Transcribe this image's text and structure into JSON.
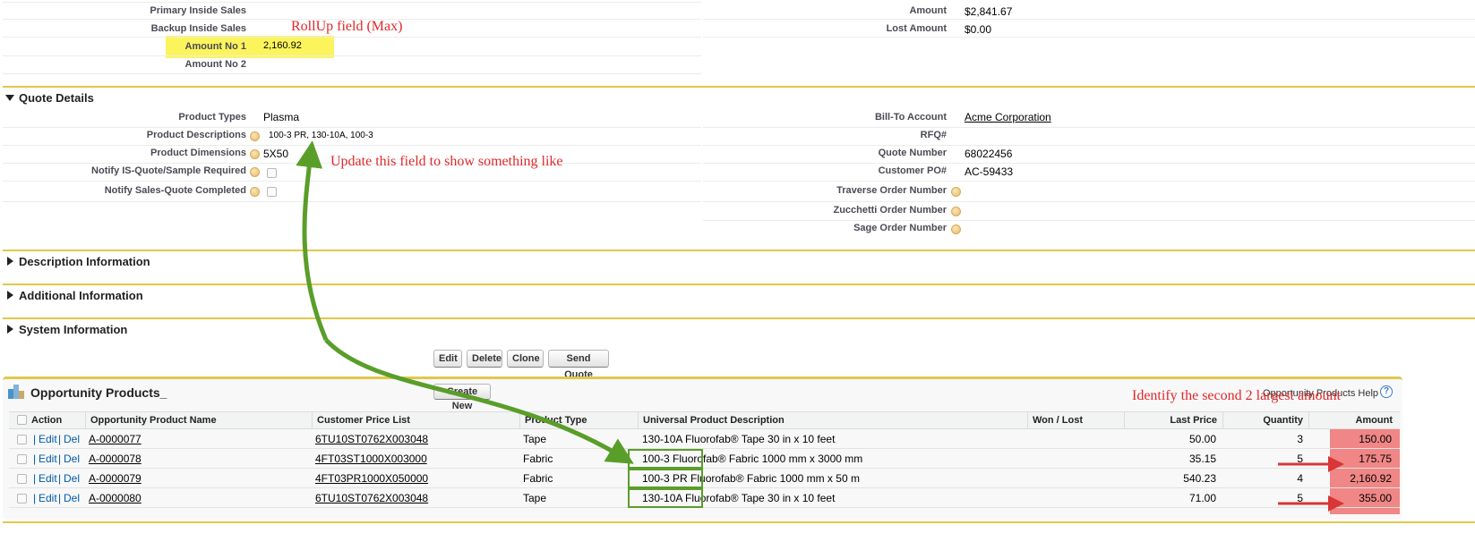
{
  "top_fields": {
    "primary_inside_sales": {
      "label": "Primary Inside Sales",
      "value": ""
    },
    "backup_inside_sales": {
      "label": "Backup Inside Sales",
      "value": ""
    },
    "amount_no_1": {
      "label": "Amount No 1",
      "value": "2,160.92"
    },
    "amount_no_2": {
      "label": "Amount No 2",
      "value": ""
    },
    "amount": {
      "label": "Amount",
      "value": "$2,841.67"
    },
    "lost_amount": {
      "label": "Lost Amount",
      "value": "$0.00"
    }
  },
  "quote_details": {
    "title": "Quote Details",
    "product_types": {
      "label": "Product Types",
      "value": "Plasma"
    },
    "product_descriptions": {
      "label": "Product Descriptions",
      "value": "100-3 PR, 130-10A, 100-3"
    },
    "product_dimensions": {
      "label": "Product Dimensions",
      "value": "5X50"
    },
    "notify_is_quote": {
      "label": "Notify IS-Quote/Sample Required"
    },
    "notify_sales_quote": {
      "label": "Notify Sales-Quote Completed"
    },
    "bill_to_account": {
      "label": "Bill-To Account",
      "value": "Acme Corporation"
    },
    "rfq": {
      "label": "RFQ#",
      "value": ""
    },
    "quote_number": {
      "label": "Quote Number",
      "value": "68022456"
    },
    "customer_po": {
      "label": "Customer PO#",
      "value": "AC-59433"
    },
    "traverse_order": {
      "label": "Traverse Order Number"
    },
    "zucchetti_order": {
      "label": "Zucchetti Order Number"
    },
    "sage_order": {
      "label": "Sage Order Number"
    }
  },
  "sections": {
    "description": "Description Information",
    "additional": "Additional Information",
    "system": "System Information"
  },
  "buttons": {
    "edit": "Edit",
    "delete": "Delete",
    "clone": "Clone",
    "send_quote": "Send Quote",
    "create_new": "Create New"
  },
  "related_list": {
    "title": "Opportunity Products_",
    "help_link": "Opportunity Products Help",
    "help_icon": "?",
    "columns": {
      "action": "Action",
      "name": "Opportunity Product Name",
      "price_list": "Customer Price List",
      "type": "Product Type",
      "desc": "Universal Product Description",
      "won_lost": "Won / Lost",
      "last_price": "Last Price",
      "quantity": "Quantity",
      "amount": "Amount"
    },
    "action_links": {
      "sep": "|",
      "edit": "Edit",
      "del": "Del"
    },
    "rows": [
      {
        "name": "A-0000077",
        "price_list": "6TU10ST0762X003048",
        "type": "Tape",
        "desc": "130-10A Fluorofab® Tape 30 in x 10 feet",
        "won_lost": "",
        "last_price": "50.00",
        "quantity": "3",
        "amount": "150.00"
      },
      {
        "name": "A-0000078",
        "price_list": "4FT03ST1000X003000",
        "type": "Fabric",
        "desc": "100-3 Fluorofab® Fabric 1000 mm x 3000 mm",
        "won_lost": "",
        "last_price": "35.15",
        "quantity": "5",
        "amount": "175.75"
      },
      {
        "name": "A-0000079",
        "price_list": "4FT03PR1000X050000",
        "type": "Fabric",
        "desc": "100-3 PR Fluorofab® Fabric 1000 mm x 50 m",
        "won_lost": "",
        "last_price": "540.23",
        "quantity": "4",
        "amount": "2,160.92"
      },
      {
        "name": "A-0000080",
        "price_list": "6TU10ST0762X003048",
        "type": "Tape",
        "desc": "130-10A Fluorofab® Tape 30 in x 10 feet",
        "won_lost": "",
        "last_price": "71.00",
        "quantity": "5",
        "amount": "355.00"
      }
    ]
  },
  "annotations": {
    "rollup": "RollUp field (Max)",
    "update": "Update this field  to show something like",
    "identify": "Identify the second 2 largest amount"
  },
  "colors": {
    "highlight": "#fbf45c",
    "annotation": "#e0282a",
    "arrow": "#5a9e2a",
    "amount_col": "#ef8080",
    "section_line": "#e1c84a"
  },
  "icons": {
    "caret_down": "caret-down-icon",
    "caret_right": "caret-right-icon",
    "help": "help-bubble-icon",
    "products": "products-icon"
  }
}
